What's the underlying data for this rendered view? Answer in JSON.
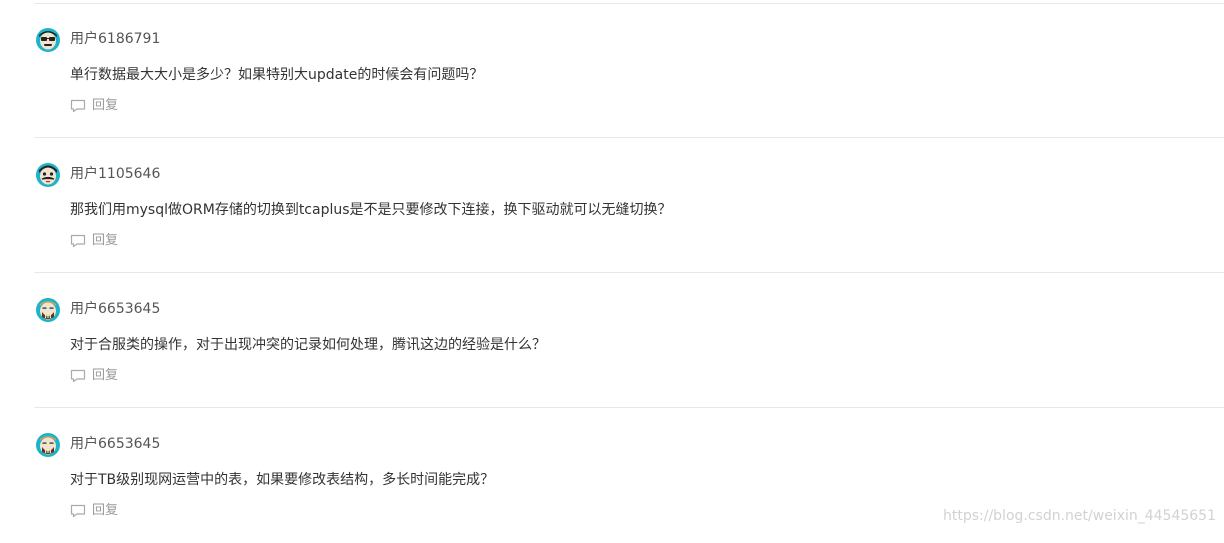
{
  "comments": [
    {
      "username": "用户6186791",
      "avatar": "glasses-face-avatar",
      "text": "单行数据最大大小是多少？如果特别大update的时候会有问题吗？",
      "reply_label": "回复"
    },
    {
      "username": "用户1105646",
      "avatar": "mustache-face-avatar",
      "text": "那我们用mysql做ORM存储的切换到tcaplus是不是只要修改下连接，换下驱动就可以无缝切换？",
      "reply_label": "回复"
    },
    {
      "username": "用户6653645",
      "avatar": "bearded-face-avatar",
      "text": "对于合服类的操作，对于出现冲突的记录如何处理，腾讯这边的经验是什么？",
      "reply_label": "回复"
    },
    {
      "username": "用户6653645",
      "avatar": "bearded-face-avatar",
      "text": "对于TB级别现网运营中的表，如果要修改表结构，多长时间能完成？",
      "reply_label": "回复"
    }
  ],
  "watermark": "https://blog.csdn.net/weixin_44545651",
  "colors": {
    "divider": "#e8e8e8",
    "avatar_bg": "#1db3c8",
    "text": "#333333",
    "muted": "#999999"
  }
}
